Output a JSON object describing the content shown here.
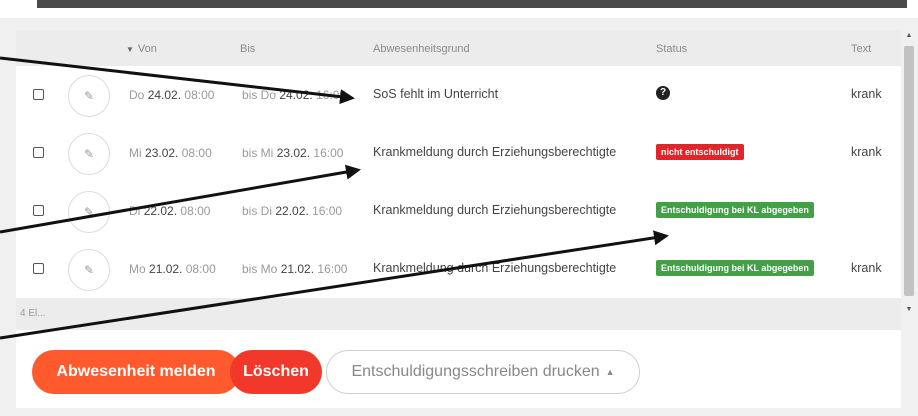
{
  "table": {
    "headers": {
      "von": "Von",
      "bis": "Bis",
      "grund": "Abwesenheitsgrund",
      "status": "Status",
      "text": "Text"
    },
    "rows": [
      {
        "von_day": "Do",
        "von_date": "24.02.",
        "von_time": "08:00",
        "bis_day": "bis Do",
        "bis_date": "24.02.",
        "bis_time": "16:00",
        "reason": "SoS fehlt im Unterricht",
        "status_type": "unknown",
        "status_label": "?",
        "text": "krank"
      },
      {
        "von_day": "Mi",
        "von_date": "23.02.",
        "von_time": "08:00",
        "bis_day": "bis Mi",
        "bis_date": "23.02.",
        "bis_time": "16:00",
        "reason": "Krankmeldung durch Erziehungsberechtigte",
        "status_type": "red",
        "status_label": "nicht entschuldigt",
        "text": "krank"
      },
      {
        "von_day": "Di",
        "von_date": "22.02.",
        "von_time": "08:00",
        "bis_day": "bis Di",
        "bis_date": "22.02.",
        "bis_time": "16:00",
        "reason": "Krankmeldung durch Erziehungsberechtigte",
        "status_type": "green",
        "status_label": "Entschuldigung bei KL abgegeben",
        "text": ""
      },
      {
        "von_day": "Mo",
        "von_date": "21.02.",
        "von_time": "08:00",
        "bis_day": "bis Mo",
        "bis_date": "21.02.",
        "bis_time": "16:00",
        "reason": "Krankmeldung durch Erziehungsberechtigte",
        "status_type": "green",
        "status_label": "Entschuldigung bei KL abgegeben",
        "text": "krank"
      }
    ],
    "footer": "4 El..."
  },
  "actions": {
    "report": "Abwesenheit melden",
    "delete": "Löschen",
    "print": "Entschuldigungsschreiben drucken"
  },
  "icons": {
    "sort": "sort-desc-icon",
    "edit": "pencil-icon",
    "status_unknown": "question-circle-icon",
    "dropdown": "caret-up-icon"
  },
  "colors": {
    "status_red": "#e0262a",
    "status_green": "#43a047",
    "button_orange": "#ff5a2e",
    "button_red": "#f2372b"
  }
}
